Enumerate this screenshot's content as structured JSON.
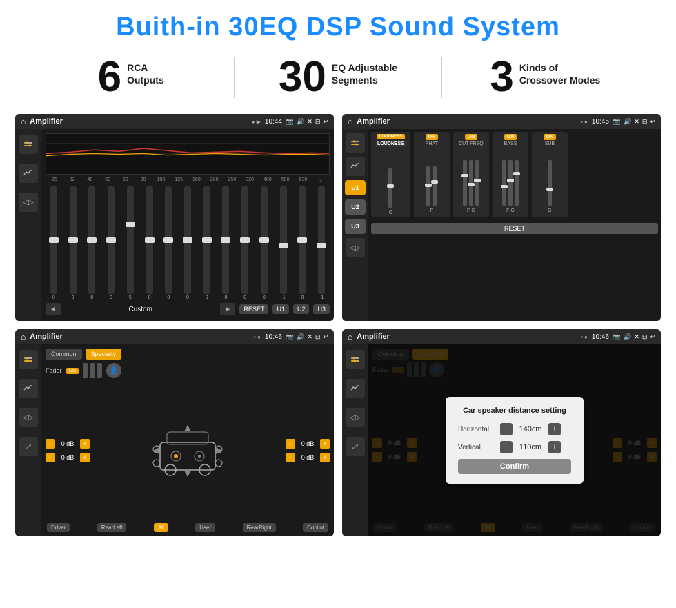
{
  "page": {
    "title": "Buith-in 30EQ DSP Sound System",
    "bg_color": "#ffffff"
  },
  "stats": [
    {
      "number": "6",
      "label_line1": "RCA",
      "label_line2": "Outputs"
    },
    {
      "number": "30",
      "label_line1": "EQ Adjustable",
      "label_line2": "Segments"
    },
    {
      "number": "3",
      "label_line1": "Kinds of",
      "label_line2": "Crossover Modes"
    }
  ],
  "screens": [
    {
      "id": "eq-screen",
      "title": "Amplifier",
      "time": "10:44",
      "type": "eq"
    },
    {
      "id": "amp-screen",
      "title": "Amplifier",
      "time": "10:45",
      "type": "amp"
    },
    {
      "id": "cross-screen",
      "title": "Amplifier",
      "time": "10:46",
      "type": "crossover"
    },
    {
      "id": "dist-screen",
      "title": "Amplifier",
      "time": "10:46",
      "type": "distance"
    }
  ],
  "eq": {
    "freq_labels": [
      "25",
      "32",
      "40",
      "50",
      "63",
      "80",
      "100",
      "125",
      "160",
      "200",
      "250",
      "320",
      "400",
      "500",
      "630"
    ],
    "values": [
      "0",
      "0",
      "0",
      "0",
      "5",
      "0",
      "0",
      "0",
      "0",
      "0",
      "0",
      "0",
      "-1",
      "0",
      "-1"
    ],
    "preset": "Custom",
    "buttons": [
      "RESET",
      "U1",
      "U2",
      "U3"
    ]
  },
  "amp": {
    "channels": [
      {
        "name": "LOUDNESS",
        "on": true
      },
      {
        "name": "PHAT",
        "on": true
      },
      {
        "name": "CUT FREQ",
        "on": true
      },
      {
        "name": "BASS",
        "on": true
      },
      {
        "name": "SUB",
        "on": true
      }
    ],
    "u_buttons": [
      "U1",
      "U2",
      "U3"
    ],
    "reset_label": "RESET"
  },
  "crossover": {
    "tabs": [
      "Common",
      "Specialty"
    ],
    "fader_label": "Fader",
    "on_label": "ON",
    "bottom_labels": [
      "Driver",
      "RearLeft",
      "All",
      "User",
      "RearRight",
      "Copilot"
    ],
    "db_values": [
      "0 dB",
      "0 dB",
      "0 dB",
      "0 dB"
    ]
  },
  "distance": {
    "tabs": [
      "Common",
      "Specialty"
    ],
    "modal": {
      "title": "Car speaker distance setting",
      "horizontal_label": "Horizontal",
      "horizontal_value": "140cm",
      "vertical_label": "Vertical",
      "vertical_value": "110cm",
      "confirm_label": "Confirm"
    },
    "bottom_labels": [
      "Driver",
      "RearLeft",
      "All",
      "User",
      "RearRight",
      "Copilot"
    ],
    "db_values": [
      "0 dB",
      "0 dB"
    ]
  }
}
